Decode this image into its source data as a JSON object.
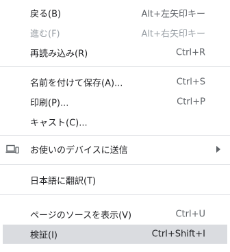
{
  "menu": {
    "back": {
      "label": "戻る(B)",
      "shortcut": "Alt+左矢印キー"
    },
    "forward": {
      "label": "進む(F)",
      "shortcut": "Alt+右矢印キー"
    },
    "reload": {
      "label": "再読み込み(R)",
      "shortcut": "Ctrl+R"
    },
    "save_as": {
      "label": "名前を付けて保存(A)...",
      "shortcut": "Ctrl+S"
    },
    "print": {
      "label": "印刷(P)...",
      "shortcut": "Ctrl+P"
    },
    "cast": {
      "label": "キャスト(C)..."
    },
    "send_to_devices": {
      "label": "お使いのデバイスに送信",
      "icon": "devices-icon"
    },
    "translate": {
      "label": "日本語に翻訳(T)"
    },
    "view_source": {
      "label": "ページのソースを表示(V)",
      "shortcut": "Ctrl+U"
    },
    "inspect": {
      "label": "検証(I)",
      "shortcut": "Ctrl+Shift+I"
    }
  }
}
